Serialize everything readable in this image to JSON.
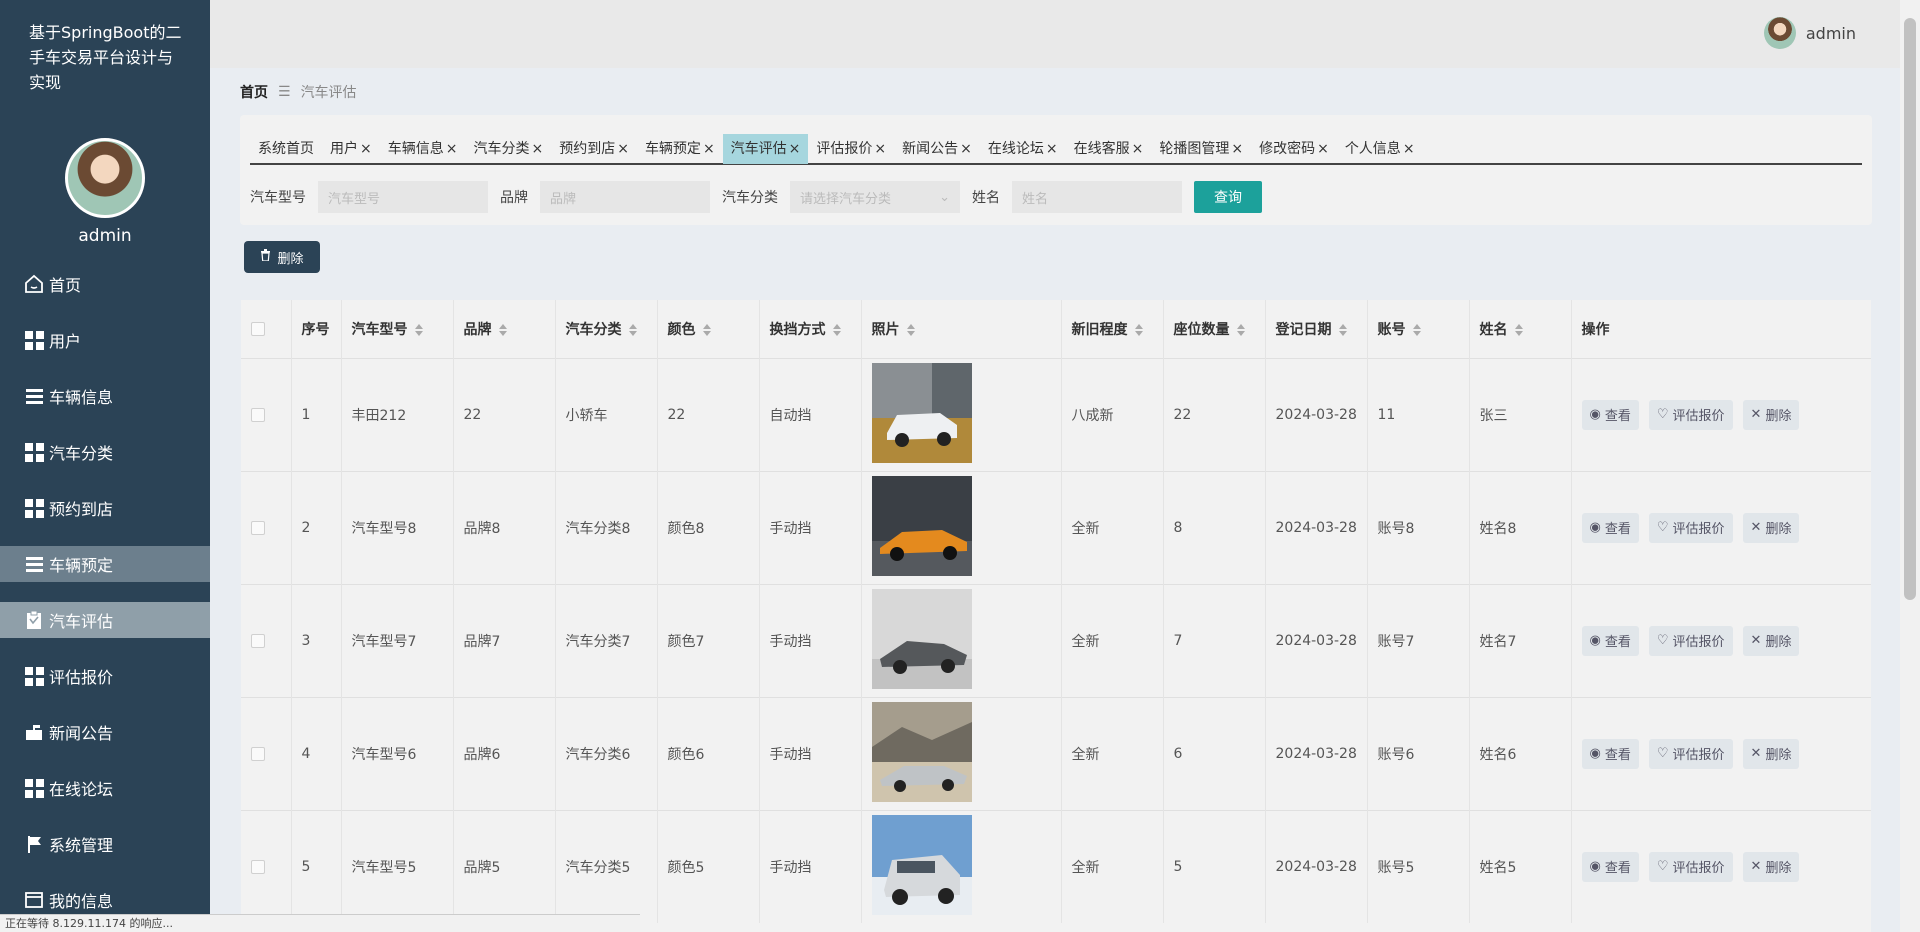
{
  "app": {
    "system_title": "基于SpringBoot的二手车交易平台设计与实现",
    "sidebar_username": "admin"
  },
  "header": {
    "username": "admin"
  },
  "sidebar": {
    "items": [
      {
        "label": "首页",
        "icon": "home-icon"
      },
      {
        "label": "用户",
        "icon": "grid-icon"
      },
      {
        "label": "车辆信息",
        "icon": "list-icon"
      },
      {
        "label": "汽车分类",
        "icon": "grid-icon"
      },
      {
        "label": "预约到店",
        "icon": "grid-icon"
      },
      {
        "label": "车辆预定",
        "icon": "list-icon"
      },
      {
        "label": "汽车评估",
        "icon": "clipboard-icon"
      },
      {
        "label": "评估报价",
        "icon": "grid-icon"
      },
      {
        "label": "新闻公告",
        "icon": "mailbox-icon"
      },
      {
        "label": "在线论坛",
        "icon": "grid-icon"
      },
      {
        "label": "系统管理",
        "icon": "flag-icon"
      },
      {
        "label": "我的信息",
        "icon": "window-icon"
      }
    ]
  },
  "breadcrumb": {
    "home": "首页",
    "separator": "☰",
    "current": "汽车评估"
  },
  "tabs": [
    {
      "label": "系统首页",
      "closable": false
    },
    {
      "label": "用户",
      "closable": true
    },
    {
      "label": "车辆信息",
      "closable": true
    },
    {
      "label": "汽车分类",
      "closable": true
    },
    {
      "label": "预约到店",
      "closable": true
    },
    {
      "label": "车辆预定",
      "closable": true
    },
    {
      "label": "汽车评估",
      "closable": true,
      "active": true
    },
    {
      "label": "评估报价",
      "closable": true
    },
    {
      "label": "新闻公告",
      "closable": true
    },
    {
      "label": "在线论坛",
      "closable": true
    },
    {
      "label": "在线客服",
      "closable": true
    },
    {
      "label": "轮播图管理",
      "closable": true
    },
    {
      "label": "修改密码",
      "closable": true
    },
    {
      "label": "个人信息",
      "closable": true
    }
  ],
  "search": {
    "model_label": "汽车型号",
    "model_placeholder": "汽车型号",
    "brand_label": "品牌",
    "brand_placeholder": "品牌",
    "category_label": "汽车分类",
    "category_placeholder": "请选择汽车分类",
    "name_label": "姓名",
    "name_placeholder": "姓名",
    "query_button": "查询"
  },
  "toolbar": {
    "delete_label": "删除"
  },
  "table": {
    "columns": [
      "序号",
      "汽车型号",
      "品牌",
      "汽车分类",
      "颜色",
      "换挡方式",
      "照片",
      "新旧程度",
      "座位数量",
      "登记日期",
      "账号",
      "姓名",
      "操作"
    ],
    "rows": [
      {
        "index": "1",
        "model": "丰田212",
        "brand": "22",
        "category": "小轿车",
        "color": "22",
        "transmission": "自动挡",
        "condition": "八成新",
        "seats": "22",
        "date": "2024-03-28",
        "account": "11",
        "name": "张三"
      },
      {
        "index": "2",
        "model": "汽车型号8",
        "brand": "品牌8",
        "category": "汽车分类8",
        "color": "颜色8",
        "transmission": "手动挡",
        "condition": "全新",
        "seats": "8",
        "date": "2024-03-28",
        "account": "账号8",
        "name": "姓名8"
      },
      {
        "index": "3",
        "model": "汽车型号7",
        "brand": "品牌7",
        "category": "汽车分类7",
        "color": "颜色7",
        "transmission": "手动挡",
        "condition": "全新",
        "seats": "7",
        "date": "2024-03-28",
        "account": "账号7",
        "name": "姓名7"
      },
      {
        "index": "4",
        "model": "汽车型号6",
        "brand": "品牌6",
        "category": "汽车分类6",
        "color": "颜色6",
        "transmission": "手动挡",
        "condition": "全新",
        "seats": "6",
        "date": "2024-03-28",
        "account": "账号6",
        "name": "姓名6"
      },
      {
        "index": "5",
        "model": "汽车型号5",
        "brand": "品牌5",
        "category": "汽车分类5",
        "color": "颜色5",
        "transmission": "手动挡",
        "condition": "全新",
        "seats": "5",
        "date": "2024-03-28",
        "account": "账号5",
        "name": "姓名5"
      }
    ],
    "actions": {
      "view": "查看",
      "evaluate": "评估报价",
      "delete": "删除"
    }
  },
  "statusbar": {
    "text": "正在等待 8.129.11.174 的响应..."
  },
  "colors": {
    "sidebar_bg": "#2b4356",
    "accent": "#1ca19b",
    "active_tab": "#a6d6de"
  }
}
